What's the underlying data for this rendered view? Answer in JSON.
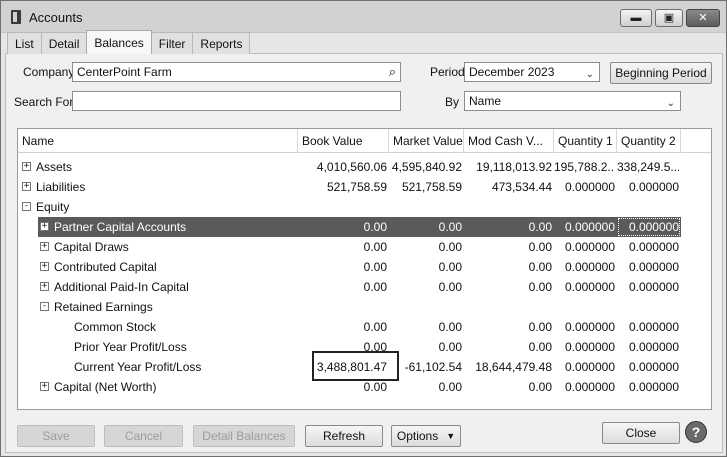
{
  "window": {
    "title": "Accounts",
    "icon": "book-icon",
    "buttons": [
      "minimize-icon",
      "maximize-icon",
      "close-icon"
    ]
  },
  "tabs": [
    {
      "label": "List",
      "active": false
    },
    {
      "label": "Detail",
      "active": false
    },
    {
      "label": "Balances",
      "active": true
    },
    {
      "label": "Filter",
      "active": false
    },
    {
      "label": "Reports",
      "active": false
    }
  ],
  "form": {
    "company_label": "Company",
    "company_value": "CenterPoint Farm",
    "period_label": "Period",
    "period_value": "December 2023",
    "beginning_period_button": "Beginning Period",
    "search_label": "Search For",
    "search_value": "",
    "by_label": "By",
    "by_value": "Name"
  },
  "grid": {
    "columns": [
      "Name",
      "Book Value",
      "Market Value",
      "Mod Cash V...",
      "Quantity 1",
      "Quantity 2"
    ],
    "rows": [
      {
        "name": "Assets",
        "level": 0,
        "expander": "+",
        "book": "4,010,560.06",
        "market": "4,595,840.92",
        "modcash": "19,118,013.92",
        "q1": "195,788.2...",
        "q2": "338,249.5..."
      },
      {
        "name": "Liabilities",
        "level": 0,
        "expander": "+",
        "book": "521,758.59",
        "market": "521,758.59",
        "modcash": "473,534.44",
        "q1": "0.000000",
        "q2": "0.000000"
      },
      {
        "name": "Equity",
        "level": 0,
        "expander": "-",
        "book": "",
        "market": "",
        "modcash": "",
        "q1": "",
        "q2": ""
      },
      {
        "name": "Partner Capital Accounts",
        "level": 1,
        "expander": "+",
        "book": "0.00",
        "market": "0.00",
        "modcash": "0.00",
        "q1": "0.000000",
        "q2": "0.000000",
        "selected": true
      },
      {
        "name": "Capital Draws",
        "level": 1,
        "expander": "+",
        "book": "0.00",
        "market": "0.00",
        "modcash": "0.00",
        "q1": "0.000000",
        "q2": "0.000000"
      },
      {
        "name": "Contributed Capital",
        "level": 1,
        "expander": "+",
        "book": "0.00",
        "market": "0.00",
        "modcash": "0.00",
        "q1": "0.000000",
        "q2": "0.000000"
      },
      {
        "name": "Additional Paid-In Capital",
        "level": 1,
        "expander": "+",
        "book": "0.00",
        "market": "0.00",
        "modcash": "0.00",
        "q1": "0.000000",
        "q2": "0.000000"
      },
      {
        "name": "Retained Earnings",
        "level": 1,
        "expander": "-",
        "book": "",
        "market": "",
        "modcash": "",
        "q1": "",
        "q2": ""
      },
      {
        "name": "Common Stock",
        "level": 2,
        "expander": "",
        "book": "0.00",
        "market": "0.00",
        "modcash": "0.00",
        "q1": "0.000000",
        "q2": "0.000000"
      },
      {
        "name": "Prior Year Profit/Loss",
        "level": 2,
        "expander": "",
        "book": "0.00",
        "market": "0.00",
        "modcash": "0.00",
        "q1": "0.000000",
        "q2": "0.000000"
      },
      {
        "name": "Current Year Profit/Loss",
        "level": 2,
        "expander": "",
        "book": "3,488,801.47",
        "market": "-61,102.54",
        "modcash": "18,644,479.48",
        "q1": "0.000000",
        "q2": "0.000000",
        "highlight_book": true
      },
      {
        "name": "Capital (Net Worth)",
        "level": 1,
        "expander": "+",
        "book": "0.00",
        "market": "0.00",
        "modcash": "0.00",
        "q1": "0.000000",
        "q2": "0.000000"
      }
    ]
  },
  "footer": {
    "save": "Save",
    "cancel": "Cancel",
    "detail_balances": "Detail Balances",
    "refresh": "Refresh",
    "options": "Options",
    "close": "Close",
    "help": "?"
  }
}
